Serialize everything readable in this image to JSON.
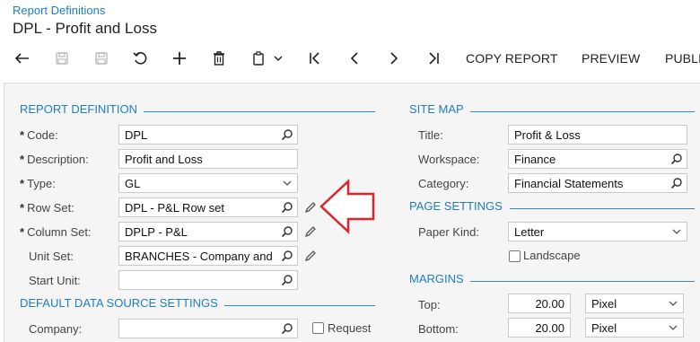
{
  "header": {
    "breadcrumb": "Report Definitions",
    "title": "DPL - Profit and Loss"
  },
  "toolbar": {
    "icons": [
      "undo-icon",
      "save-close-icon",
      "save-icon",
      "cancel-icon",
      "add-icon",
      "delete-icon",
      "copy-paste-icon",
      "chevron-down-icon",
      "first-record-icon",
      "previous-record-icon",
      "next-record-icon",
      "last-record-icon"
    ],
    "copy_report": "COPY REPORT",
    "preview": "PREVIEW",
    "publish": "PUBLI"
  },
  "report_definition": {
    "section_title": "REPORT DEFINITION",
    "code": {
      "label": "Code:",
      "value": "DPL"
    },
    "description": {
      "label": "Description:",
      "value": "Profit and Loss"
    },
    "type": {
      "label": "Type:",
      "value": "GL"
    },
    "row_set": {
      "label": "Row Set:",
      "value": "DPL - P&L Row set"
    },
    "column_set": {
      "label": "Column Set:",
      "value": "DPLP - P&L"
    },
    "unit_set": {
      "label": "Unit Set:",
      "value": "BRANCHES - Company and Branc"
    },
    "start_unit": {
      "label": "Start Unit:",
      "value": ""
    },
    "required_marker": "*"
  },
  "default_data_source": {
    "section_title": "DEFAULT DATA SOURCE SETTINGS",
    "company": {
      "label": "Company:",
      "value": ""
    },
    "request_label": "Request"
  },
  "site_map": {
    "section_title": "SITE MAP",
    "title": {
      "label": "Title:",
      "value": "Profit & Loss"
    },
    "workspace": {
      "label": "Workspace:",
      "value": "Finance"
    },
    "category": {
      "label": "Category:",
      "value": "Financial Statements"
    }
  },
  "page_settings": {
    "section_title": "PAGE SETTINGS",
    "paper_kind": {
      "label": "Paper Kind:",
      "value": "Letter"
    },
    "landscape_label": "Landscape"
  },
  "margins": {
    "section_title": "MARGINS",
    "top": {
      "label": "Top:",
      "value": "20.00",
      "unit": "Pixel"
    },
    "bottom": {
      "label": "Bottom:",
      "value": "20.00",
      "unit": "Pixel"
    }
  },
  "colors": {
    "accent": "#1f7ec2",
    "annotation_arrow": "#e0232a"
  }
}
